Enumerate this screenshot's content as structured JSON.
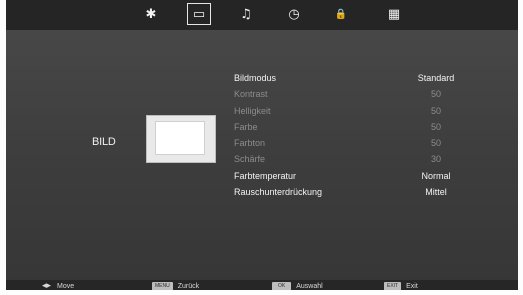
{
  "tabs": [
    {
      "icon": "gear-icon",
      "glyph": "✱",
      "active": false
    },
    {
      "icon": "monitor-icon",
      "glyph": "▭",
      "active": true
    },
    {
      "icon": "music-note-icon",
      "glyph": "♫",
      "active": false
    },
    {
      "icon": "clock-icon",
      "glyph": "◷",
      "active": false
    },
    {
      "icon": "lock-icon",
      "glyph": "🔒",
      "active": false
    },
    {
      "icon": "grid-icon",
      "glyph": "▦",
      "active": false
    }
  ],
  "section_label": "BILD",
  "menu": {
    "rows": [
      {
        "label": "Bildmodus",
        "value": "Standard"
      },
      {
        "label": "Kontrast",
        "value": "50"
      },
      {
        "label": "Helligkeit",
        "value": "50"
      },
      {
        "label": "Farbe",
        "value": "50"
      },
      {
        "label": "Farbton",
        "value": "50"
      },
      {
        "label": "Schärfe",
        "value": "30"
      },
      {
        "label": "Farbtemperatur",
        "value": "Normal"
      },
      {
        "label": "Rauschunterdrückung",
        "value": "Mittel"
      }
    ]
  },
  "footer": {
    "move": {
      "icon": "move-arrows-icon",
      "glyph": "◂▸",
      "label": "Move"
    },
    "back": {
      "key": "MENU",
      "label": "Zurück"
    },
    "select": {
      "key": "OK",
      "label": "Auswahl"
    },
    "exit": {
      "key": "EXIT",
      "label": "Exit"
    }
  }
}
